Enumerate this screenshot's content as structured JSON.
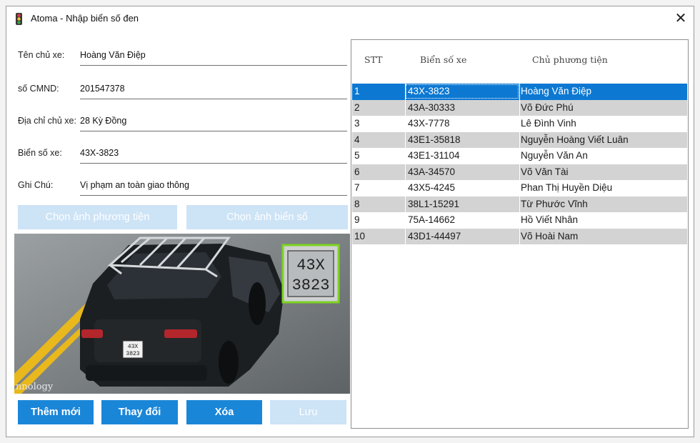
{
  "window": {
    "title": "Atoma - Nhập biển số đen",
    "close_glyph": "✕"
  },
  "form": {
    "owner_name": {
      "label": "Tên chủ xe:",
      "value": "Hoàng Văn Điệp"
    },
    "id_number": {
      "label": "số CMND:",
      "value": "201547378"
    },
    "address": {
      "label": "Địa chỉ chủ xe:",
      "value": "28 Kỳ Đồng"
    },
    "plate": {
      "label": "Biển số xe:",
      "value": "43X-3823"
    },
    "note": {
      "label": "Ghi Chú:",
      "value": "Vị phạm an toàn giao thông"
    }
  },
  "image_buttons": {
    "choose_vehicle": "Chọn ảnh phương tiện",
    "choose_plate": "Chọn ảnh biển số"
  },
  "photo": {
    "watermark": "nnology",
    "plate_line1": "43X",
    "plate_line2": "3823",
    "car_plate_line1": "43X",
    "car_plate_line2": "3823"
  },
  "actions": {
    "add": "Thêm mới",
    "edit": "Thay đổi",
    "delete": "Xóa",
    "save": "Lưu"
  },
  "grid": {
    "headers": {
      "stt": "STT",
      "plate": "Biển số xe",
      "owner": "Chủ phương tiện"
    },
    "rows": [
      {
        "stt": "1",
        "plate": "43X-3823",
        "owner": "Hoàng Văn Điệp"
      },
      {
        "stt": "2",
        "plate": "43A-30333",
        "owner": "Võ Đức Phú"
      },
      {
        "stt": "3",
        "plate": "43X-7778",
        "owner": "Lê Đình Vinh"
      },
      {
        "stt": "4",
        "plate": "43E1-35818",
        "owner": "Nguyễn Hoàng Viết Luân"
      },
      {
        "stt": "5",
        "plate": "43E1-31104",
        "owner": "Nguyễn Văn An"
      },
      {
        "stt": "6",
        "plate": "43A-34570",
        "owner": "Võ Văn Tài"
      },
      {
        "stt": "7",
        "plate": "43X5-4245",
        "owner": "Phan Thị Huyền Diệu"
      },
      {
        "stt": "8",
        "plate": "38L1-15291",
        "owner": "Từ Phước Vĩnh"
      },
      {
        "stt": "9",
        "plate": "75A-14662",
        "owner": "Hồ Viết Nhân"
      },
      {
        "stt": "10",
        "plate": "43D1-44497",
        "owner": "Võ Hoài Nam"
      }
    ]
  },
  "colors": {
    "accent": "#1a86d8",
    "disabled": "#cde3f6",
    "selection": "#0c78d2",
    "alt_row": "#d3d3d3",
    "plate_highlight": "#7ed321"
  },
  "icons": {
    "app": "traffic-light-icon",
    "close": "close-icon"
  }
}
